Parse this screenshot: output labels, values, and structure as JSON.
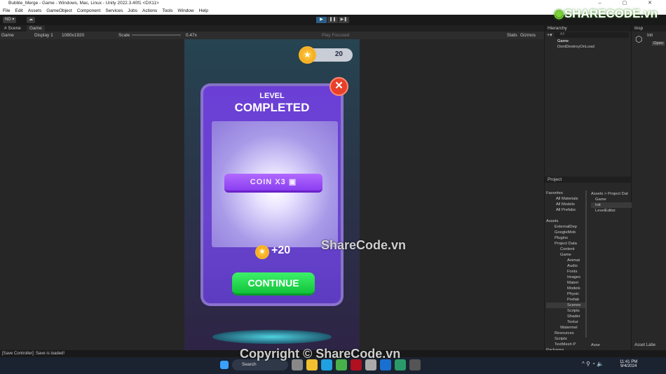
{
  "window": {
    "title": "Bubble_Merge - Game - Windows, Mac, Linux - Unity 2022.3.40f1 <DX11>",
    "controls": "– ▢ ✕"
  },
  "menu": [
    "File",
    "Edit",
    "Assets",
    "GameObject",
    "Component",
    "Services",
    "Jobs",
    "Actions",
    "Tools",
    "Window",
    "Help"
  ],
  "toolbar": {
    "account": "ND ▾",
    "cloud": "☁",
    "play": "▶",
    "pause": "❚❚",
    "step": "▶❚"
  },
  "tabs": {
    "scene": "# Scene",
    "game": "Game"
  },
  "game_toolbar": {
    "display_mode": "Game",
    "display": "Display 1",
    "resolution": "1080x1920",
    "scale_label": "Scale",
    "scale_value": "0.47x",
    "play_mode": "Play Focused",
    "stats": "Stats",
    "gizmos": "Gizmos"
  },
  "game": {
    "coin_count": "20",
    "level": "LEVEL",
    "completed": "COMPLETED",
    "coin_button": "COIN X3",
    "reward": "+20",
    "continue": "CONTINUE",
    "close": "✕"
  },
  "hierarchy": {
    "title": "Hierarchy",
    "search_placeholder": "All",
    "items": [
      "Game",
      "DontDestroyOnLoad"
    ]
  },
  "inspector": {
    "title": "Insp",
    "name": "Init",
    "open": "Open"
  },
  "project": {
    "title": "Project",
    "breadcrumb": "Assets > Project Dat",
    "favorites": {
      "label": "Favorites",
      "items": [
        "All Materials",
        "All Models",
        "All Prefabs"
      ]
    },
    "assets_label": "Assets",
    "tree": [
      "ExternalDep",
      "GoogleMob",
      "Plugins",
      "Project Data",
      "Content",
      "Game",
      "Animat",
      "Audio",
      "Fonts",
      "Images",
      "Materi",
      "Models",
      "Physic",
      "Prefab",
      "Scenes",
      "Scripts",
      "Shader",
      "Textur",
      "Watermel",
      "Resources",
      "Scripts",
      "TextMesh P",
      "Packages"
    ],
    "files": [
      "Game",
      "Init",
      "LevelEditor"
    ],
    "asset_labels": "Asset Labe",
    "slider_label": "Asse"
  },
  "status": {
    "message": "[Save Controller]: Save is loaded!"
  },
  "taskbar": {
    "search": "Search",
    "time": "11:41 PM",
    "date": "9/4/2024"
  },
  "watermarks": {
    "logo": "SHARECODE.vn",
    "center": "ShareCode.vn",
    "copyright": "Copyright © ShareCode.vn"
  },
  "colors": {
    "play_active": "#2c5d87",
    "card": "#6b3fd6",
    "continue": "#12c43a",
    "coin_button": "#8a3ef0",
    "close": "#e8402a"
  }
}
